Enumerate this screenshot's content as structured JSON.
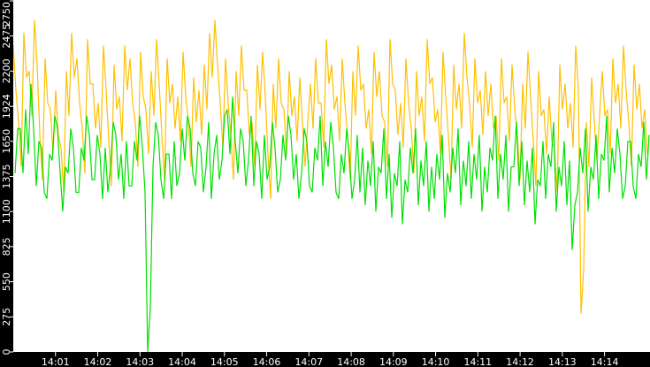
{
  "chart_data": {
    "type": "line",
    "title": "",
    "xlabel": "",
    "ylabel": "",
    "ylim": [
      0,
      2750
    ],
    "yticks": [
      "0",
      "275",
      "550",
      "825",
      "1100",
      "1375",
      "1650",
      "1924",
      "2200",
      "2475",
      "2750"
    ],
    "xticks": [
      "14:01",
      "14:02",
      "14:03",
      "14:04",
      "14:05",
      "14:06",
      "14:07",
      "14:08",
      "14:09",
      "14:10",
      "14:11",
      "14:12",
      "14:13",
      "14:14"
    ],
    "xrange_minutes": [
      0,
      14.85
    ],
    "grid": false,
    "legend": "none",
    "series": [
      {
        "name": "orange",
        "color": "#ffc000",
        "values": [
          2400,
          1800,
          2500,
          2200,
          2600,
          1700,
          2300,
          1900,
          2050,
          1600,
          2200,
          2500,
          2300,
          1750,
          2450,
          2100,
          1950,
          2400,
          1650,
          2250,
          2000,
          2400,
          2300,
          1800,
          2350,
          1900,
          2200,
          2450,
          1700,
          2300,
          2100,
          2000,
          2350,
          1800,
          2150,
          2050,
          2250,
          2500,
          2600,
          1950,
          2300,
          1700,
          2200,
          2400,
          2050,
          1800,
          2250,
          2350,
          1550,
          2100,
          2300,
          1900,
          2200,
          2000,
          2150,
          1450,
          2100,
          2300,
          1950,
          2450,
          2250,
          2000,
          2300,
          1700,
          2200,
          2400,
          2100,
          1900,
          2350,
          2200,
          1800,
          2450,
          2050,
          1950,
          2300,
          1750,
          2200,
          2000,
          2450,
          2150,
          1900,
          2350,
          1700,
          2250,
          2100,
          2500,
          1950,
          2300,
          2050,
          2200,
          2100,
          1850,
          2300,
          2000,
          2250,
          1700,
          2100,
          2350,
          1650,
          2200,
          1900,
          2000,
          1600,
          2250,
          2100,
          1950,
          2400,
          300,
          1800,
          2150,
          1500,
          2200,
          1900,
          2300,
          2100,
          2400,
          1800,
          2250,
          2100,
          1900
        ]
      },
      {
        "name": "green",
        "color": "#00e000",
        "values": [
          1400,
          1750,
          1900,
          2100,
          1300,
          1600,
          1200,
          1500,
          1750,
          1100,
          1400,
          1600,
          1250,
          1500,
          1700,
          1350,
          1550,
          1600,
          1450,
          1700,
          1550,
          1650,
          1300,
          1500,
          1600,
          0,
          1450,
          1700,
          1200,
          1550,
          1650,
          1400,
          1500,
          1750,
          1300,
          1600,
          1450,
          1200,
          1700,
          1500,
          1900,
          2000,
          1400,
          1650,
          1500,
          1300,
          1550,
          1700,
          1450,
          1600,
          1350,
          1500,
          1700,
          1550,
          1400,
          1650,
          1250,
          1500,
          1300,
          1450,
          1600,
          1200,
          1400,
          1550,
          1350,
          1250,
          1150,
          1300,
          1100,
          1400,
          1200,
          1050,
          1300,
          1000,
          1250,
          1400,
          1150,
          1300,
          1100,
          1200,
          1350,
          1050,
          1250,
          1400,
          1150,
          1300,
          1200,
          1350,
          1100,
          1250,
          1500,
          1200,
          1350,
          1100,
          1450,
          1300,
          1150,
          1250,
          1000,
          1300,
          1200,
          1450,
          1100,
          1300,
          1150,
          800,
          1250,
          1400,
          1100,
          1350,
          1200,
          1500,
          1250,
          1400,
          1550,
          1300,
          1650,
          1200,
          1450,
          1350
        ]
      }
    ]
  }
}
